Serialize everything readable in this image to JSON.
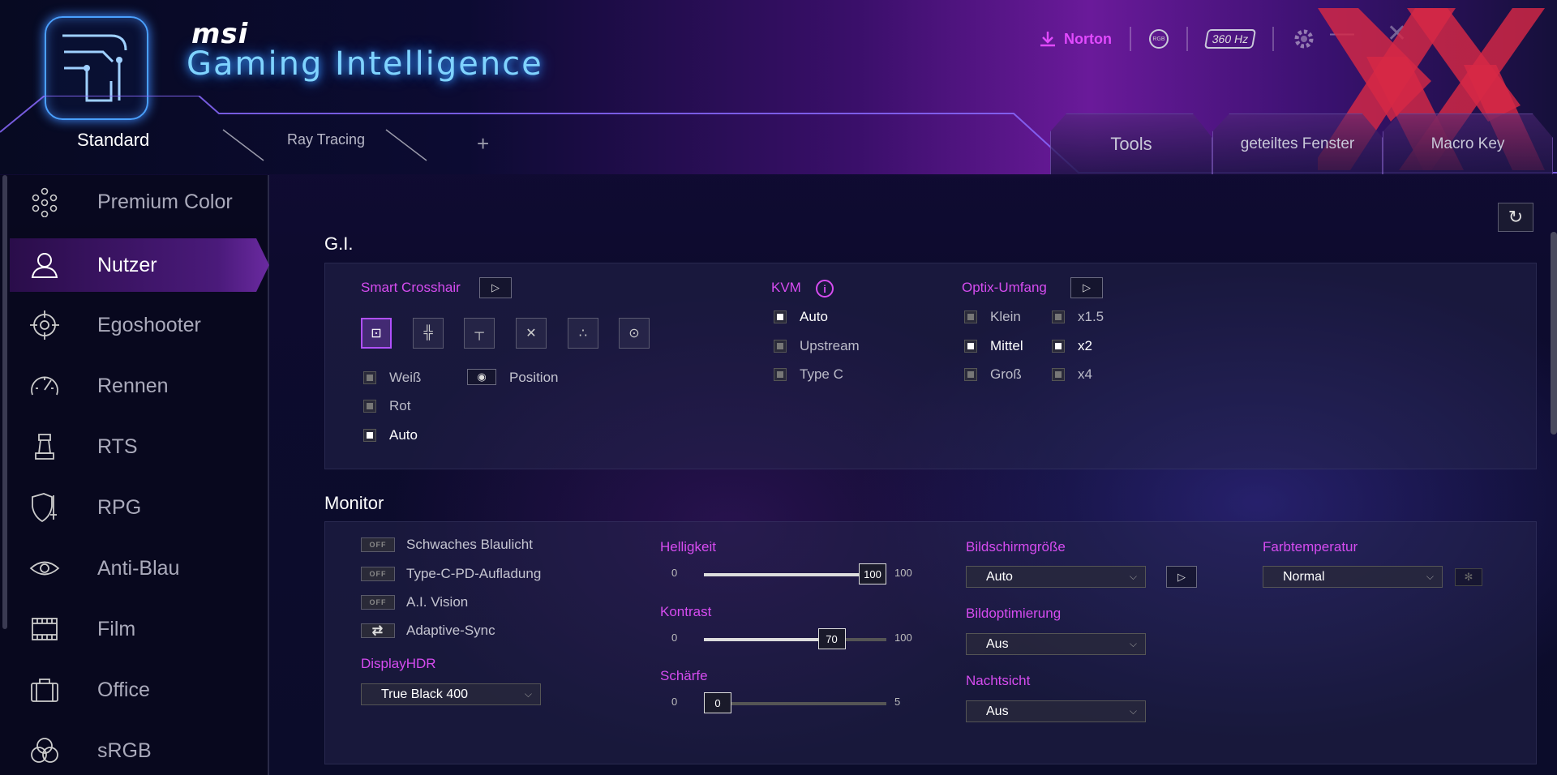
{
  "header": {
    "brand": "msi",
    "title": "Gaming Intelligence",
    "norton_label": "Norton",
    "hz_label": "360 Hz",
    "rgb_label": "RGB"
  },
  "tabs": {
    "left": [
      {
        "label": "Standard"
      },
      {
        "label": "Ray Tracing"
      },
      {
        "label": "+"
      }
    ],
    "right": [
      {
        "label": "Tools"
      },
      {
        "label": "geteiltes Fenster"
      },
      {
        "label": "Macro Key"
      }
    ]
  },
  "sidebar": {
    "items": [
      {
        "label": "Premium Color",
        "icon": "premium-color-icon"
      },
      {
        "label": "Nutzer",
        "icon": "user-icon",
        "active": true
      },
      {
        "label": "Egoshooter",
        "icon": "crosshair-icon"
      },
      {
        "label": "Rennen",
        "icon": "speedometer-icon"
      },
      {
        "label": "RTS",
        "icon": "chess-piece-icon"
      },
      {
        "label": "RPG",
        "icon": "shield-sword-icon"
      },
      {
        "label": "Anti-Blau",
        "icon": "eye-icon"
      },
      {
        "label": "Film",
        "icon": "film-icon"
      },
      {
        "label": "Office",
        "icon": "briefcase-icon"
      },
      {
        "label": "sRGB",
        "icon": "rgb-circles-icon"
      }
    ]
  },
  "gi": {
    "title": "G.I.",
    "smart_crosshair": {
      "label": "Smart Crosshair",
      "colors": [
        {
          "label": "Weiß",
          "on": false
        },
        {
          "label": "Rot",
          "on": false
        },
        {
          "label": "Auto",
          "on": true
        }
      ],
      "position_label": "Position"
    },
    "kvm": {
      "label": "KVM",
      "options": [
        {
          "label": "Auto",
          "on": true
        },
        {
          "label": "Upstream",
          "on": false
        },
        {
          "label": "Type C",
          "on": false
        }
      ]
    },
    "optix": {
      "label": "Optix-Umfang",
      "sizes": [
        {
          "label": "Klein",
          "on": false
        },
        {
          "label": "Mittel",
          "on": true
        },
        {
          "label": "Groß",
          "on": false
        }
      ],
      "zooms": [
        {
          "label": "x1.5",
          "on": false
        },
        {
          "label": "x2",
          "on": true
        },
        {
          "label": "x4",
          "on": false
        }
      ]
    }
  },
  "monitor": {
    "title": "Monitor",
    "toggles": [
      {
        "label": "Schwaches Blaulicht",
        "state": "OFF"
      },
      {
        "label": "Type-C-PD-Aufladung",
        "state": "OFF"
      },
      {
        "label": "A.I. Vision",
        "state": "OFF"
      },
      {
        "label": "Adaptive-Sync",
        "state": "SYNC"
      }
    ],
    "displayhdr": {
      "label": "DisplayHDR",
      "value": "True Black 400"
    },
    "helligkeit": {
      "label": "Helligkeit",
      "min": "0",
      "max": "100",
      "value": "100",
      "fraction": 1.0
    },
    "kontrast": {
      "label": "Kontrast",
      "min": "0",
      "max": "100",
      "value": "70",
      "fraction": 0.7
    },
    "schaerfe": {
      "label": "Schärfe",
      "min": "0",
      "max": "5",
      "value": "0",
      "fraction": 0.0
    },
    "bildschirmgroesse": {
      "label": "Bildschirmgröße",
      "value": "Auto"
    },
    "bildoptimierung": {
      "label": "Bildoptimierung",
      "value": "Aus"
    },
    "nachtsicht": {
      "label": "Nachtsicht",
      "value": "Aus"
    },
    "farbtemperatur": {
      "label": "Farbtemperatur",
      "value": "Normal"
    }
  }
}
